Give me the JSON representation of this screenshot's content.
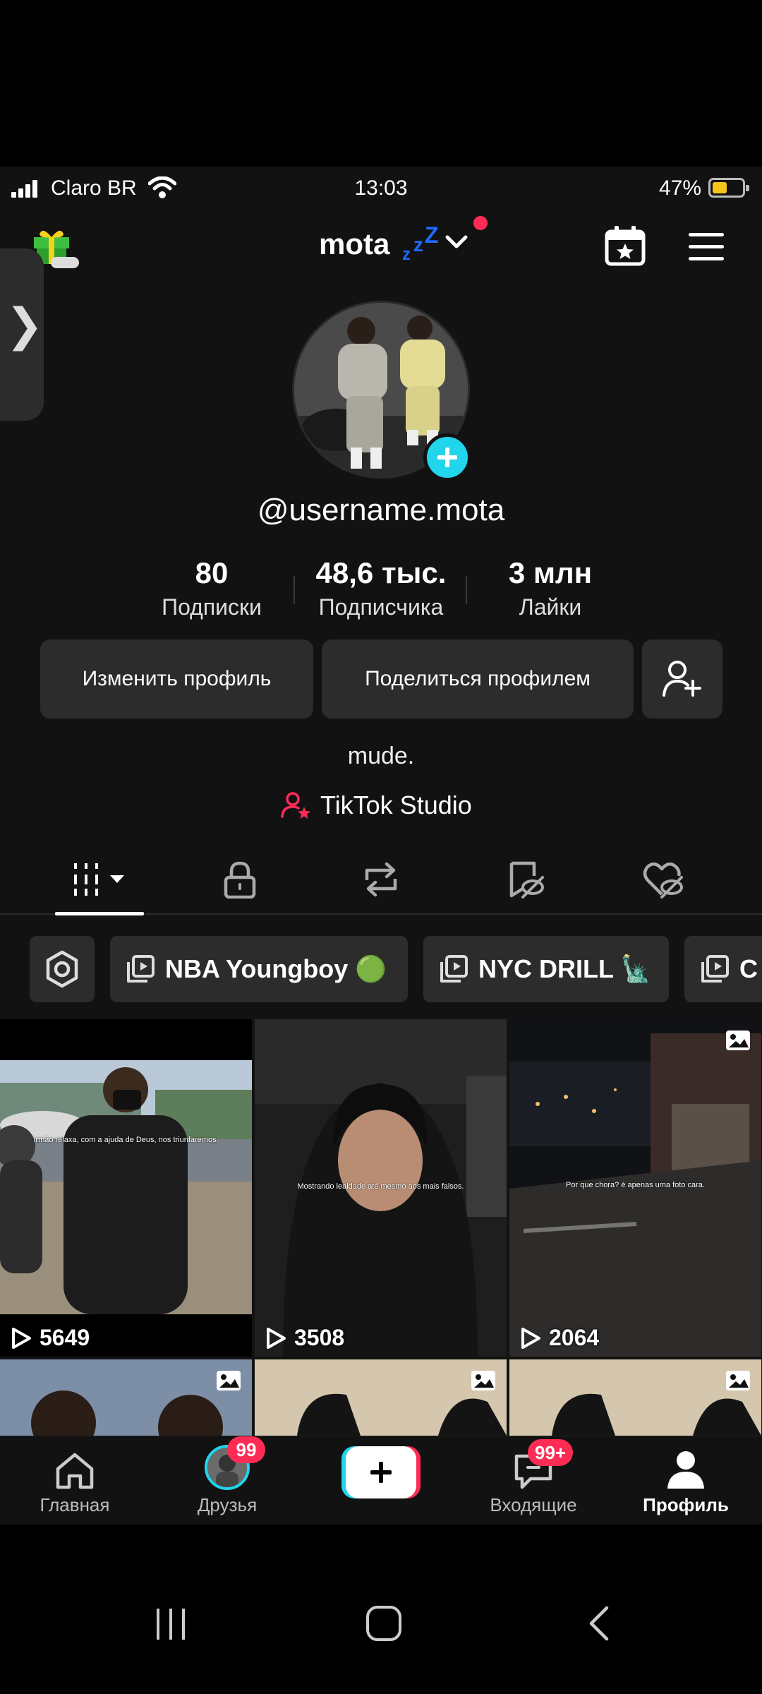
{
  "status_bar": {
    "carrier": "Claro BR",
    "time": "13:03",
    "battery_percent": "47%",
    "battery_level": 0.47
  },
  "header": {
    "username": "mota",
    "notification_dot": true
  },
  "profile": {
    "handle": "@username.mota",
    "following_count": "80",
    "following_label": "Подписки",
    "followers_count": "48,6 тыс.",
    "followers_label": "Подписчика",
    "likes_count": "3 млн",
    "likes_label": "Лайки",
    "edit_button": "Изменить профиль",
    "share_button": "Поделиться профилем",
    "bio": "mude.",
    "studio_link": "TikTok Studio"
  },
  "playlists": [
    {
      "label": "NBA Youngboy 🟢"
    },
    {
      "label": "NYC DRILL 🗽"
    },
    {
      "label": "C"
    }
  ],
  "videos": [
    {
      "views": "5649",
      "caption": "Irmão relaxa, com a ajuda de Deus, nos triunfaremos."
    },
    {
      "views": "3508",
      "caption": "Mostrando lealdade até mesmo aos mais falsos."
    },
    {
      "views": "2064",
      "caption": "Por que chora? é apenas uma foto cara."
    }
  ],
  "bottom_nav": {
    "home": "Главная",
    "friends": "Друзья",
    "friends_badge": "99",
    "inbox": "Входящие",
    "inbox_badge": "99+",
    "profile": "Профиль"
  },
  "colors": {
    "background": "#121212",
    "surface": "#2c2c2c",
    "accent_cyan": "#20d5ec",
    "accent_red": "#fe2c55",
    "battery": "#f6c41b"
  }
}
